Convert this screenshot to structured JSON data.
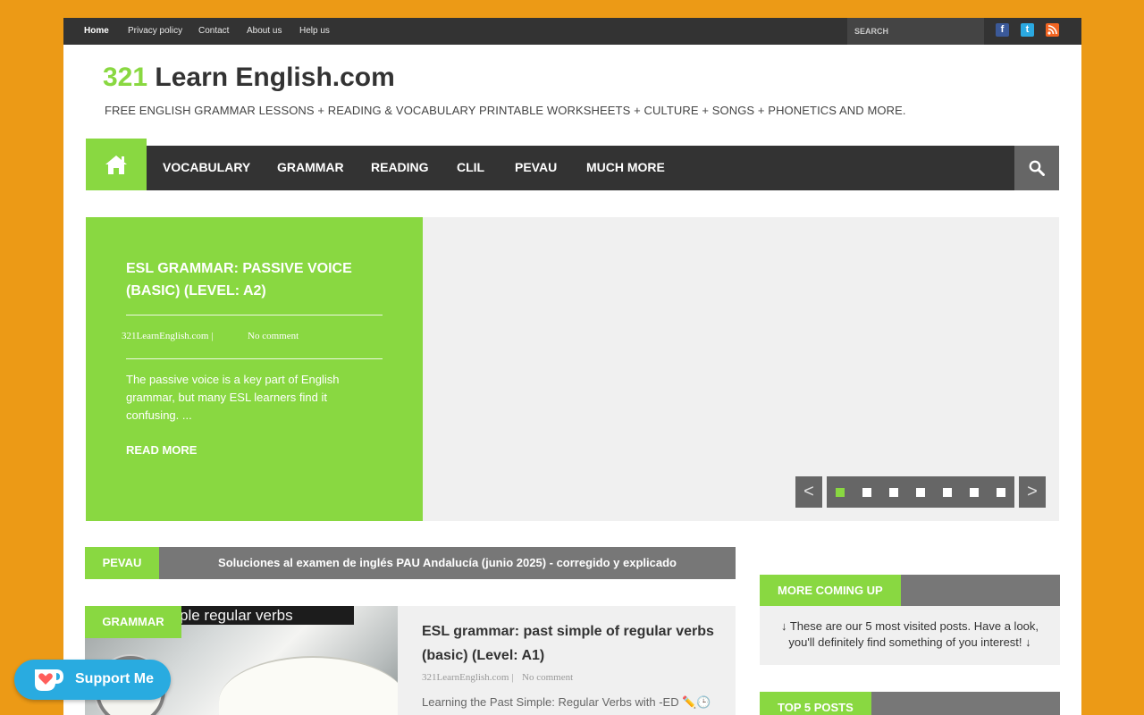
{
  "topbar": {
    "links": [
      "Home",
      "Privacy policy",
      "Contact",
      "About us",
      "Help us"
    ],
    "search_placeholder": "SEARCH",
    "social_icons": [
      "facebook-icon",
      "twitter-icon",
      "rss-icon"
    ]
  },
  "header": {
    "title_number": "321",
    "title_rest": " Learn English.com",
    "tagline": "FREE ENGLISH GRAMMAR LESSONS + READING & VOCABULARY PRINTABLE WORKSHEETS + CULTURE + SONGS + PHONETICS AND MORE."
  },
  "nav": {
    "items": [
      "VOCABULARY",
      "GRAMMAR",
      "READING",
      "CLIL",
      "PEVAU",
      "MUCH MORE"
    ]
  },
  "slider": {
    "title": "ESL GRAMMAR: PASSIVE VOICE (BASIC) (LEVEL: A2)",
    "author": "321LearnEnglish.com |",
    "comments": "No comment",
    "excerpt": "The passive voice is a key part of English grammar, but many ESL learners find it confusing. ...",
    "read_more": "READ MORE",
    "prev": "<",
    "next": ">",
    "slide_count": 7,
    "active_slide": 1
  },
  "ticker": {
    "label": "PEVAU",
    "text": "Soluciones al examen de inglés PAU Andalucía (junio 2025) - corregido y explicado"
  },
  "post": {
    "category": "GRAMMAR",
    "thumb_text": "ple regular verbs",
    "title": "ESL grammar: past simple of regular verbs (basic) (Level: A1)",
    "author": "321LearnEnglish.com |",
    "comments": "No comment",
    "excerpt": "Learning the Past Simple: Regular Verbs with -ED ✏️🕒"
  },
  "sidebar": {
    "more_title": "MORE COMING UP",
    "more_text": "↓ These are our 5 most visited posts. Have a look, you'll definitely find something of you interest! ↓",
    "top_title": "TOP 5 POSTS"
  },
  "support": {
    "label": "Support Me"
  },
  "colors": {
    "accent": "#89d841",
    "background": "#ec9a16",
    "dark": "#333333",
    "gray": "#777777",
    "kofi": "#29abe0"
  }
}
